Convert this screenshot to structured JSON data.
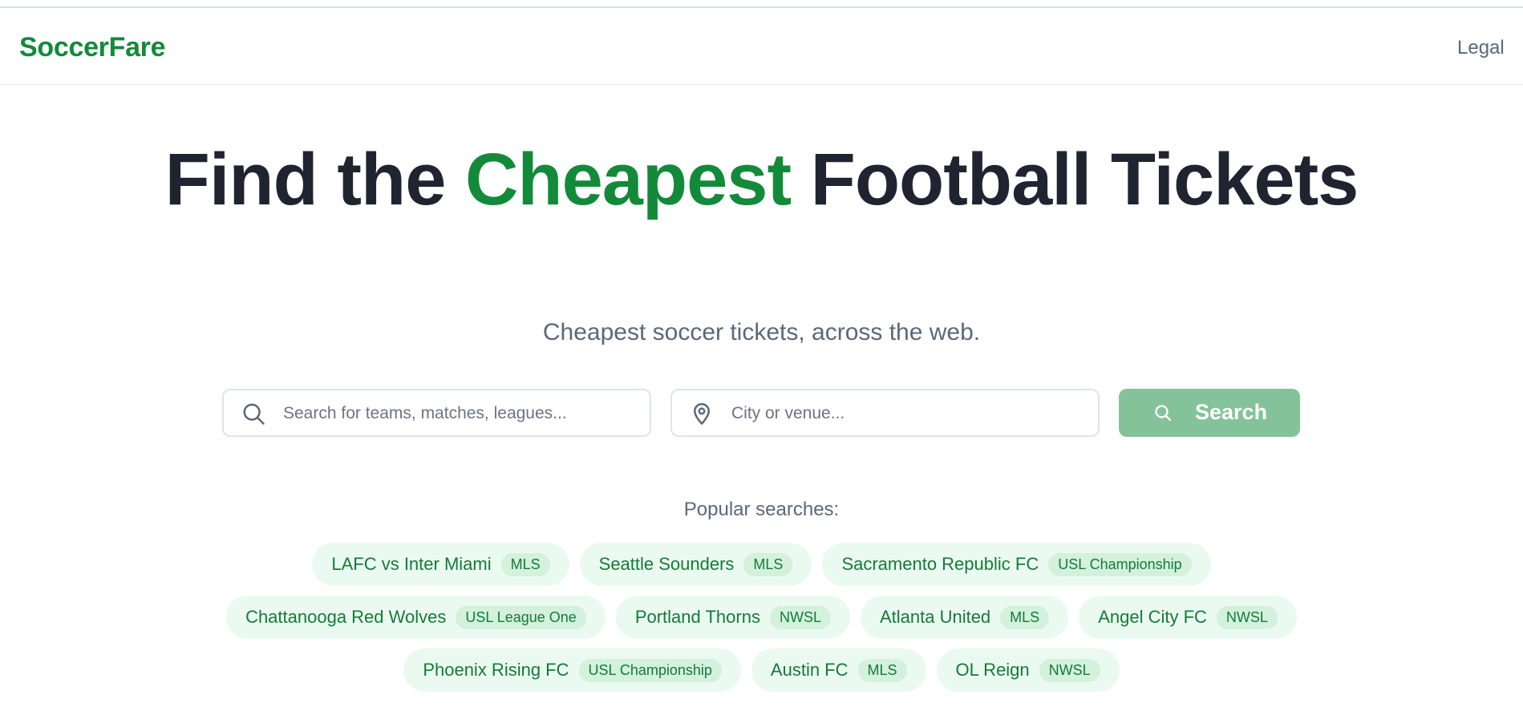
{
  "header": {
    "logo": "SoccerFare",
    "nav": {
      "legal": "Legal"
    }
  },
  "hero": {
    "title_before": "Find the ",
    "title_accent": "Cheapest",
    "title_after": " Football Tickets",
    "subtitle": "Cheapest soccer tickets, across the web."
  },
  "search": {
    "query_placeholder": "Search for teams, matches, leagues...",
    "query_value": "",
    "location_placeholder": "City or venue...",
    "location_value": "",
    "button_label": "Search"
  },
  "popular": {
    "label": "Popular searches:",
    "rows": [
      [
        {
          "name": "LAFC vs Inter Miami",
          "league": "MLS"
        },
        {
          "name": "Seattle Sounders",
          "league": "MLS"
        },
        {
          "name": "Sacramento Republic FC",
          "league": "USL Championship"
        }
      ],
      [
        {
          "name": "Chattanooga Red Wolves",
          "league": "USL League One"
        },
        {
          "name": "Portland Thorns",
          "league": "NWSL"
        },
        {
          "name": "Atlanta United",
          "league": "MLS"
        },
        {
          "name": "Angel City FC",
          "league": "NWSL"
        }
      ],
      [
        {
          "name": "Phoenix Rising FC",
          "league": "USL Championship"
        },
        {
          "name": "Austin FC",
          "league": "MLS"
        },
        {
          "name": "OL Reign",
          "league": "NWSL"
        }
      ]
    ]
  },
  "colors": {
    "brand": "#138a3a",
    "heading": "#1f2430",
    "muted": "#5c6878",
    "search_button": "#84c39a",
    "chip_bg": "#ebfaf0",
    "badge_bg": "#d3f1dd"
  },
  "icons": {
    "query": "search-icon",
    "location": "map-pin-icon",
    "button": "search-icon"
  }
}
